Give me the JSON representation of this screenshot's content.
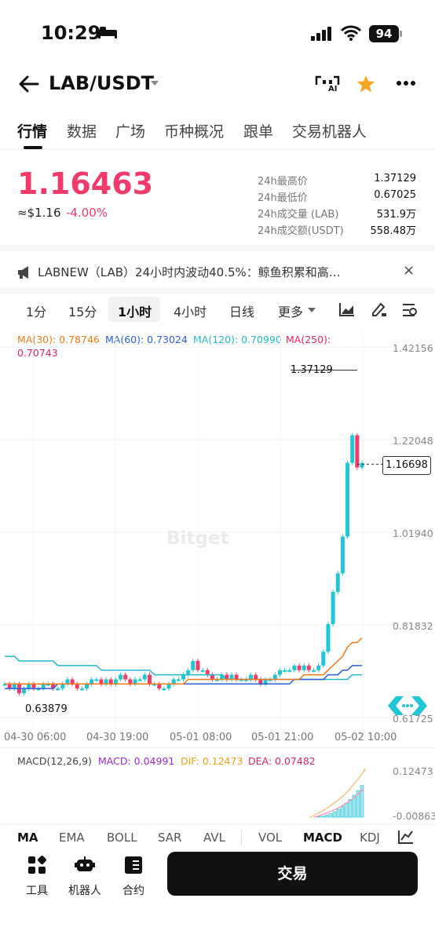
{
  "status": {
    "time": "10:29",
    "battery": "94"
  },
  "header": {
    "pair": "LAB/USDT",
    "ai_label": "AI"
  },
  "tabs": [
    "行情",
    "数据",
    "广场",
    "币种概况",
    "跟单",
    "交易机器人"
  ],
  "ticker": {
    "price": "1.16463",
    "approx": "≈$1.16",
    "change": "-4.00%",
    "stats": [
      {
        "label": "24h最高价",
        "value": "1.37129"
      },
      {
        "label": "24h最低价",
        "value": "0.67025"
      },
      {
        "label": "24h成交量 (LAB)",
        "value": "531.9万"
      },
      {
        "label": "24h成交额(USDT)",
        "value": "558.48万"
      }
    ]
  },
  "notice": "LABNEW（LAB）24小时内波动40.5%：鲸鱼积累和高…",
  "intervals": [
    "1分",
    "15分",
    "1小时",
    "4小时",
    "日线",
    "更多"
  ],
  "chart": {
    "ma": [
      {
        "label": "MA(30): 0.78746",
        "color": "#f07a1a"
      },
      {
        "label": "MA(60): 0.73024",
        "color": "#2b5fd9"
      },
      {
        "label": "MA(120): 0.70990",
        "color": "#22b7c9"
      },
      {
        "label": "MA(250):",
        "color": "#e0245e"
      }
    ],
    "ma250_value": "0.70743",
    "y_ticks": [
      "1.42156",
      "1.22048",
      "1.01940",
      "0.81832",
      "0.61725"
    ],
    "x_ticks": [
      "04-30 06:00",
      "04-30 19:00",
      "05-01 08:00",
      "05-01 21:00",
      "05-02 10:00"
    ],
    "high_marker": "1.37129",
    "low_marker": "0.63879",
    "last_price": "1.16698",
    "watermark": "Bitget",
    "macd_legend": [
      {
        "label": "MACD(12,26,9)",
        "color": "#444"
      },
      {
        "label": "MACD: 0.04991",
        "color": "#9b2bd6"
      },
      {
        "label": "DIF: 0.12473",
        "color": "#e8a317"
      },
      {
        "label": "DEA: 0.07482",
        "color": "#e0245e"
      }
    ],
    "macd_ticks": [
      "0.12473",
      "-0.00863"
    ]
  },
  "chart_data": {
    "type": "candlestick",
    "x_ticks": [
      "04-30 06:00",
      "04-30 19:00",
      "05-01 08:00",
      "05-01 21:00",
      "05-02 10:00"
    ],
    "ylim": [
      0.61725,
      1.42156
    ],
    "close": [
      0.69,
      0.68,
      0.69,
      0.67,
      0.68,
      0.69,
      0.68,
      0.68,
      0.69,
      0.69,
      0.68,
      0.68,
      0.69,
      0.7,
      0.69,
      0.68,
      0.68,
      0.69,
      0.7,
      0.7,
      0.69,
      0.7,
      0.69,
      0.7,
      0.71,
      0.7,
      0.69,
      0.7,
      0.7,
      0.71,
      0.69,
      0.69,
      0.68,
      0.68,
      0.69,
      0.7,
      0.7,
      0.71,
      0.72,
      0.74,
      0.72,
      0.72,
      0.71,
      0.7,
      0.7,
      0.71,
      0.7,
      0.71,
      0.7,
      0.7,
      0.7,
      0.71,
      0.7,
      0.69,
      0.7,
      0.7,
      0.71,
      0.72,
      0.72,
      0.72,
      0.73,
      0.72,
      0.73,
      0.72,
      0.72,
      0.73,
      0.76,
      0.82,
      0.89,
      0.93,
      1.01,
      1.17,
      1.23,
      1.16,
      1.17
    ],
    "ma30": [
      0.69,
      0.69,
      0.69,
      0.69,
      0.69,
      0.69,
      0.69,
      0.69,
      0.69,
      0.69,
      0.69,
      0.69,
      0.69,
      0.69,
      0.69,
      0.69,
      0.69,
      0.69,
      0.69,
      0.69,
      0.69,
      0.69,
      0.69,
      0.69,
      0.69,
      0.69,
      0.69,
      0.69,
      0.69,
      0.69,
      0.69,
      0.69,
      0.69,
      0.69,
      0.69,
      0.69,
      0.69,
      0.69,
      0.7,
      0.7,
      0.7,
      0.7,
      0.7,
      0.7,
      0.7,
      0.7,
      0.7,
      0.7,
      0.7,
      0.7,
      0.7,
      0.7,
      0.7,
      0.7,
      0.7,
      0.7,
      0.7,
      0.7,
      0.7,
      0.7,
      0.7,
      0.7,
      0.71,
      0.71,
      0.71,
      0.71,
      0.71,
      0.72,
      0.73,
      0.74,
      0.75,
      0.77,
      0.78,
      0.78,
      0.79
    ],
    "ma60": [
      0.68,
      0.68,
      0.68,
      0.68,
      0.68,
      0.68,
      0.68,
      0.68,
      0.68,
      0.68,
      0.68,
      0.69,
      0.69,
      0.69,
      0.69,
      0.69,
      0.69,
      0.69,
      0.69,
      0.69,
      0.69,
      0.69,
      0.69,
      0.69,
      0.69,
      0.69,
      0.69,
      0.69,
      0.69,
      0.69,
      0.69,
      0.69,
      0.69,
      0.69,
      0.69,
      0.69,
      0.69,
      0.69,
      0.69,
      0.69,
      0.69,
      0.69,
      0.69,
      0.69,
      0.69,
      0.69,
      0.69,
      0.69,
      0.69,
      0.69,
      0.69,
      0.69,
      0.69,
      0.69,
      0.69,
      0.69,
      0.69,
      0.69,
      0.69,
      0.69,
      0.7,
      0.7,
      0.7,
      0.7,
      0.7,
      0.7,
      0.7,
      0.71,
      0.71,
      0.71,
      0.72,
      0.72,
      0.73,
      0.73,
      0.73
    ],
    "ma120": [
      0.75,
      0.75,
      0.75,
      0.74,
      0.74,
      0.74,
      0.74,
      0.74,
      0.74,
      0.74,
      0.74,
      0.73,
      0.73,
      0.73,
      0.73,
      0.73,
      0.73,
      0.73,
      0.73,
      0.73,
      0.72,
      0.72,
      0.72,
      0.72,
      0.72,
      0.72,
      0.72,
      0.72,
      0.72,
      0.72,
      0.72,
      0.71,
      0.71,
      0.71,
      0.71,
      0.71,
      0.71,
      0.71,
      0.71,
      0.71,
      0.71,
      0.71,
      0.71,
      0.71,
      0.71,
      0.71,
      0.7,
      0.7,
      0.7,
      0.7,
      0.7,
      0.7,
      0.7,
      0.7,
      0.7,
      0.7,
      0.7,
      0.7,
      0.7,
      0.7,
      0.7,
      0.7,
      0.7,
      0.7,
      0.7,
      0.7,
      0.7,
      0.7,
      0.7,
      0.7,
      0.7,
      0.7,
      0.71,
      0.71,
      0.71
    ]
  },
  "bottom_tabs": [
    "MA",
    "EMA",
    "BOLL",
    "SAR",
    "AVL",
    "VOL",
    "MACD",
    "KDJ"
  ],
  "nav": {
    "tools": "工具",
    "bot": "机器人",
    "contract": "合约",
    "trade": "交易"
  }
}
